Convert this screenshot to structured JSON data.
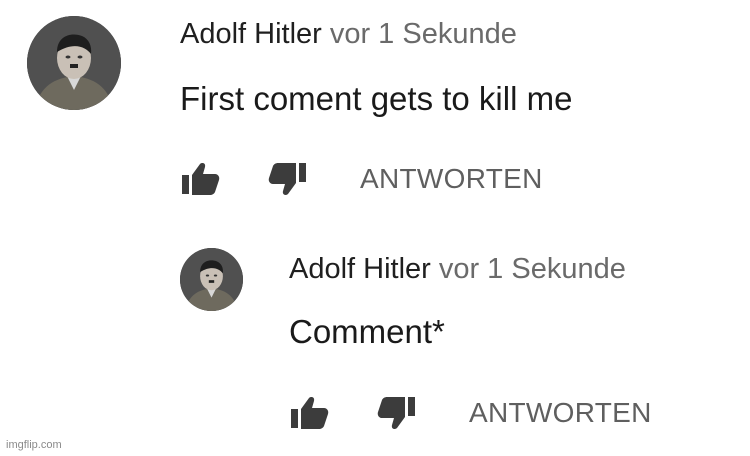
{
  "comments": [
    {
      "author": "Adolf Hitler",
      "timestamp": "vor 1 Sekunde",
      "text": "First coment gets to kill me",
      "reply_label": "ANTWORTEN",
      "avatar_icon": "avatar-portrait",
      "like_icon": "thumbs-up-icon",
      "dislike_icon": "thumbs-down-icon"
    },
    {
      "author": "Adolf Hitler",
      "timestamp": "vor 1 Sekunde",
      "text": "Comment*",
      "reply_label": "ANTWORTEN",
      "avatar_icon": "avatar-portrait",
      "like_icon": "thumbs-up-icon",
      "dislike_icon": "thumbs-down-icon"
    }
  ],
  "watermark": "imgflip.com",
  "colors": {
    "author": "#1f1f1f",
    "timestamp": "#6a6a6a",
    "text": "#1a1a1a",
    "reply": "#5f5f5f",
    "icon": "#3c3c3c"
  }
}
